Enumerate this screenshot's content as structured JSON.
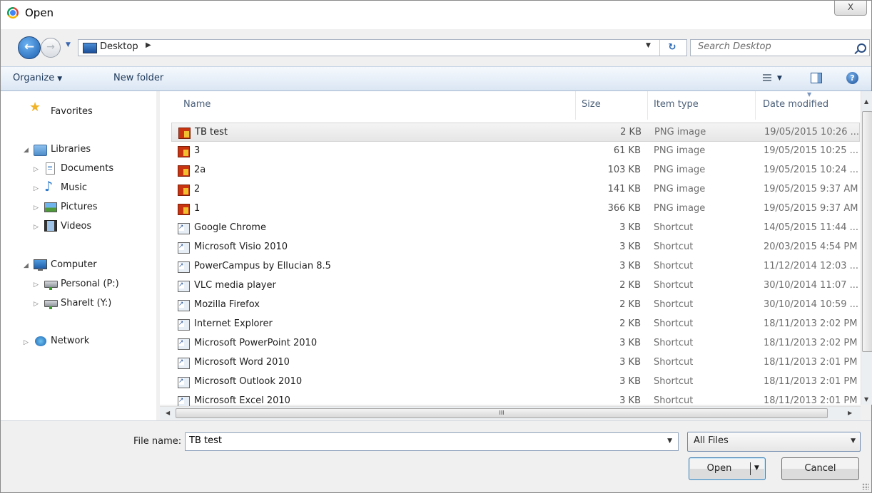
{
  "window": {
    "title": "Open",
    "close_glyph": "X"
  },
  "address": {
    "location": "Desktop",
    "search_placeholder": "Search Desktop"
  },
  "toolbar": {
    "organize_label": "Organize",
    "new_folder_label": "New folder"
  },
  "nav": {
    "favorites": "Favorites",
    "libraries": "Libraries",
    "documents": "Documents",
    "music": "Music",
    "pictures": "Pictures",
    "videos": "Videos",
    "computer": "Computer",
    "personal": "Personal (P:)",
    "shareit": "ShareIt (Y:)",
    "network": "Network"
  },
  "columns": {
    "name": "Name",
    "size": "Size",
    "type": "Item type",
    "date": "Date modified"
  },
  "files": [
    {
      "name": "TB test",
      "size": "2 KB",
      "type": "PNG image",
      "date": "19/05/2015 10:26 ...",
      "icon": "png-icon"
    },
    {
      "name": "3",
      "size": "61 KB",
      "type": "PNG image",
      "date": "19/05/2015 10:25 ...",
      "icon": "png-icon"
    },
    {
      "name": "2a",
      "size": "103 KB",
      "type": "PNG image",
      "date": "19/05/2015 10:24 ...",
      "icon": "png-icon"
    },
    {
      "name": "2",
      "size": "141 KB",
      "type": "PNG image",
      "date": "19/05/2015 9:37 AM",
      "icon": "png-icon"
    },
    {
      "name": "1",
      "size": "366 KB",
      "type": "PNG image",
      "date": "19/05/2015 9:37 AM",
      "icon": "png-icon"
    },
    {
      "name": "Google Chrome",
      "size": "3 KB",
      "type": "Shortcut",
      "date": "14/05/2015 11:44 ...",
      "icon": "chrome-shortcut-icon"
    },
    {
      "name": "Microsoft Visio 2010",
      "size": "3 KB",
      "type": "Shortcut",
      "date": "20/03/2015 4:54 PM",
      "icon": "visio-shortcut-icon"
    },
    {
      "name": "PowerCampus by Ellucian 8.5",
      "size": "3 KB",
      "type": "Shortcut",
      "date": "11/12/2014 12:03 ...",
      "icon": "powercampus-shortcut-icon"
    },
    {
      "name": "VLC media player",
      "size": "2 KB",
      "type": "Shortcut",
      "date": "30/10/2014 11:07 ...",
      "icon": "vlc-shortcut-icon"
    },
    {
      "name": "Mozilla Firefox",
      "size": "2 KB",
      "type": "Shortcut",
      "date": "30/10/2014 10:59 ...",
      "icon": "firefox-shortcut-icon"
    },
    {
      "name": "Internet Explorer",
      "size": "2 KB",
      "type": "Shortcut",
      "date": "18/11/2013 2:02 PM",
      "icon": "ie-shortcut-icon"
    },
    {
      "name": "Microsoft PowerPoint 2010",
      "size": "3 KB",
      "type": "Shortcut",
      "date": "18/11/2013 2:02 PM",
      "icon": "powerpoint-shortcut-icon"
    },
    {
      "name": "Microsoft Word 2010",
      "size": "3 KB",
      "type": "Shortcut",
      "date": "18/11/2013 2:01 PM",
      "icon": "word-shortcut-icon"
    },
    {
      "name": "Microsoft Outlook 2010",
      "size": "3 KB",
      "type": "Shortcut",
      "date": "18/11/2013 2:01 PM",
      "icon": "outlook-shortcut-icon"
    },
    {
      "name": "Microsoft Excel 2010",
      "size": "3 KB",
      "type": "Shortcut",
      "date": "18/11/2013 2:01 PM",
      "icon": "excel-shortcut-icon"
    }
  ],
  "bottom": {
    "filename_label": "File name:",
    "filename_value": "TB test",
    "filter_value": "All Files",
    "open_label": "Open",
    "cancel_label": "Cancel"
  },
  "hscroll_glyph": "III"
}
